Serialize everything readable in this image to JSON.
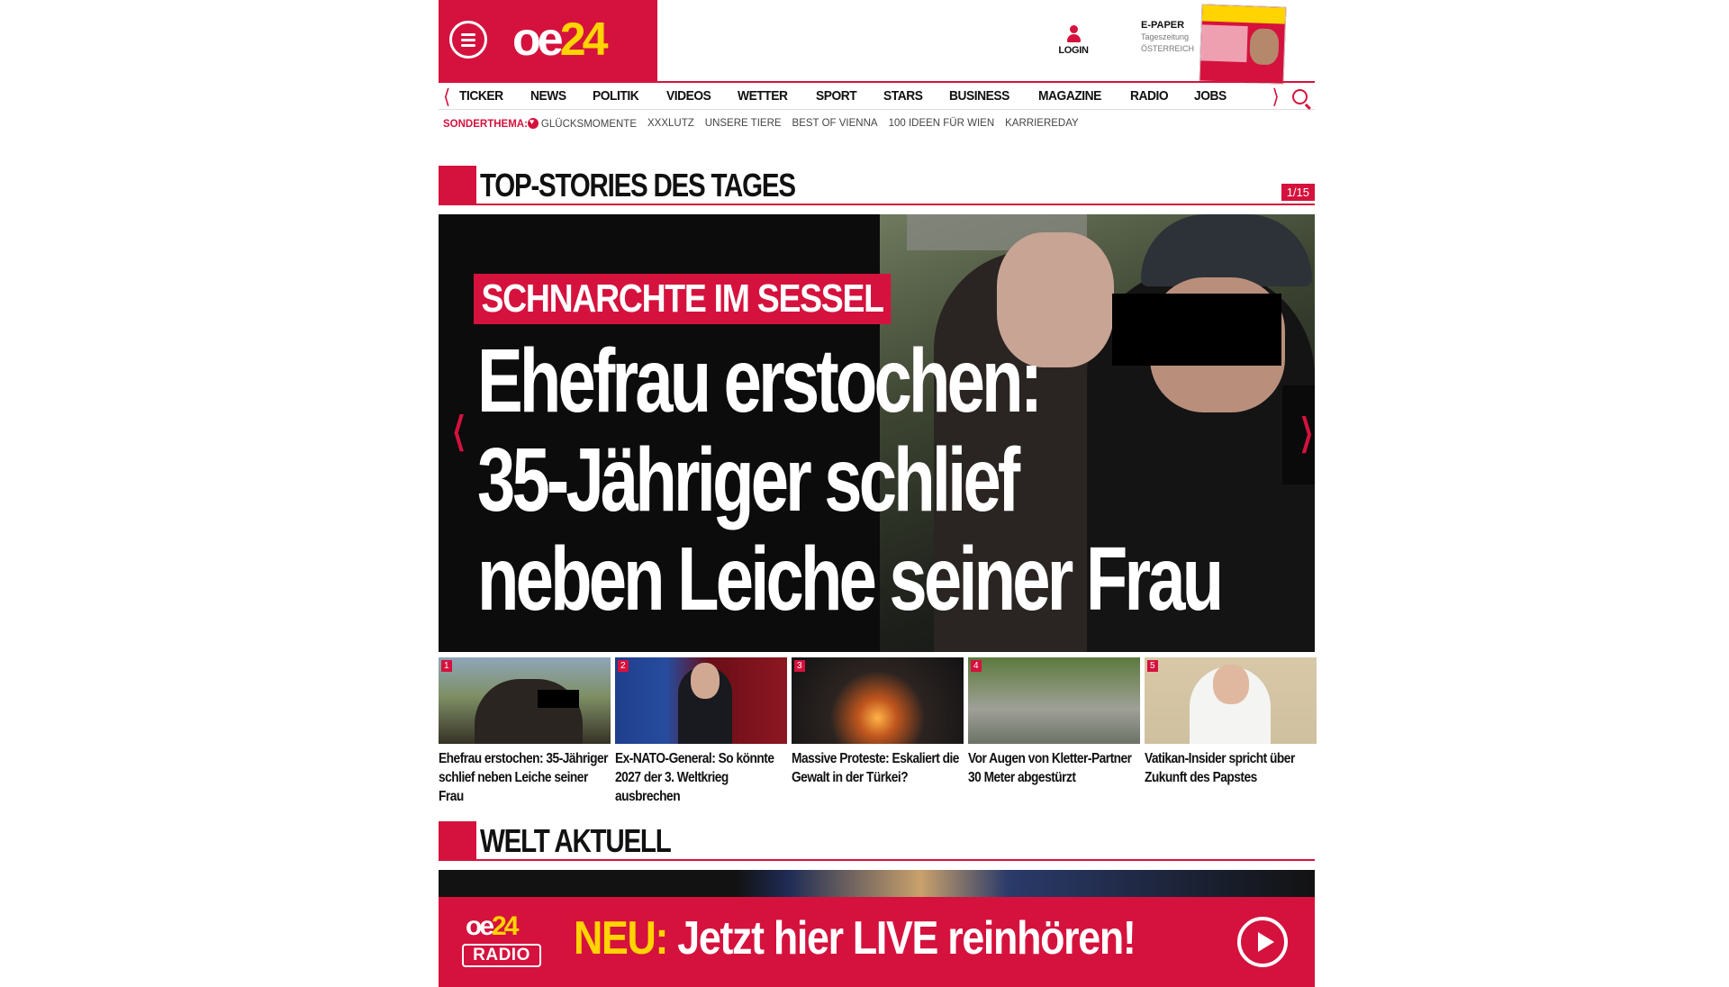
{
  "header": {
    "logo_oe": "oe",
    "logo_num": "24",
    "login_label": "LOGIN",
    "epaper_title": "E-PAPER",
    "epaper_sub1": "Tageszeitung",
    "epaper_sub2": "ÖSTERREICH"
  },
  "nav": {
    "items": [
      "TICKER",
      "NEWS",
      "POLITIK",
      "VIDEOS",
      "WETTER",
      "SPORT",
      "STARS",
      "BUSINESS",
      "MAGAZINE",
      "RADIO",
      "JOBS"
    ]
  },
  "subnav": {
    "label": "SONDERTHEMA:",
    "items": [
      "GLÜCKSMOMENTE",
      "XXXLUTZ",
      "UNSERE TIERE",
      "BEST OF VIENNA",
      "100 IDEEN FÜR WIEN",
      "KARRIEREDAY"
    ]
  },
  "top_stories": {
    "title": "TOP-STORIES DES TAGES",
    "counter": "1/15",
    "hero": {
      "kicker": "SCHNARCHTE IM SESSEL",
      "headline_line1": "Ehefrau erstochen:",
      "headline_line2": "35-Jähriger schlief",
      "headline_line3": "neben Leiche seiner Frau"
    },
    "thumbs": [
      {
        "num": "1",
        "title": "Ehefrau erstochen: 35-Jähriger schlief neben Leiche seiner Frau"
      },
      {
        "num": "2",
        "title": "Ex-NATO-General: So könnte 2027 der 3. Weltkrieg ausbrechen"
      },
      {
        "num": "3",
        "title": "Massive Proteste: Eskaliert die Gewalt in der Türkei?"
      },
      {
        "num": "4",
        "title": "Vor Augen von Kletter-Partner 30 Meter abgestürzt"
      },
      {
        "num": "5",
        "title": "Vatikan-Insider spricht über Zukunft des Papstes"
      }
    ]
  },
  "welt": {
    "title": "WELT AKTUELL"
  },
  "radio_banner": {
    "logo_top_oe": "oe",
    "logo_top_num": "24",
    "logo_bottom": "RADIO",
    "neu": "NEU:",
    "text": " Jetzt hier LIVE reinhören!"
  },
  "colors": {
    "brand_red": "#d5123d",
    "brand_yellow": "#ffd400"
  },
  "icons": [
    "menu-icon",
    "user-icon",
    "search-icon",
    "heart-icon",
    "chevron-left-icon",
    "chevron-right-icon",
    "play-icon"
  ]
}
